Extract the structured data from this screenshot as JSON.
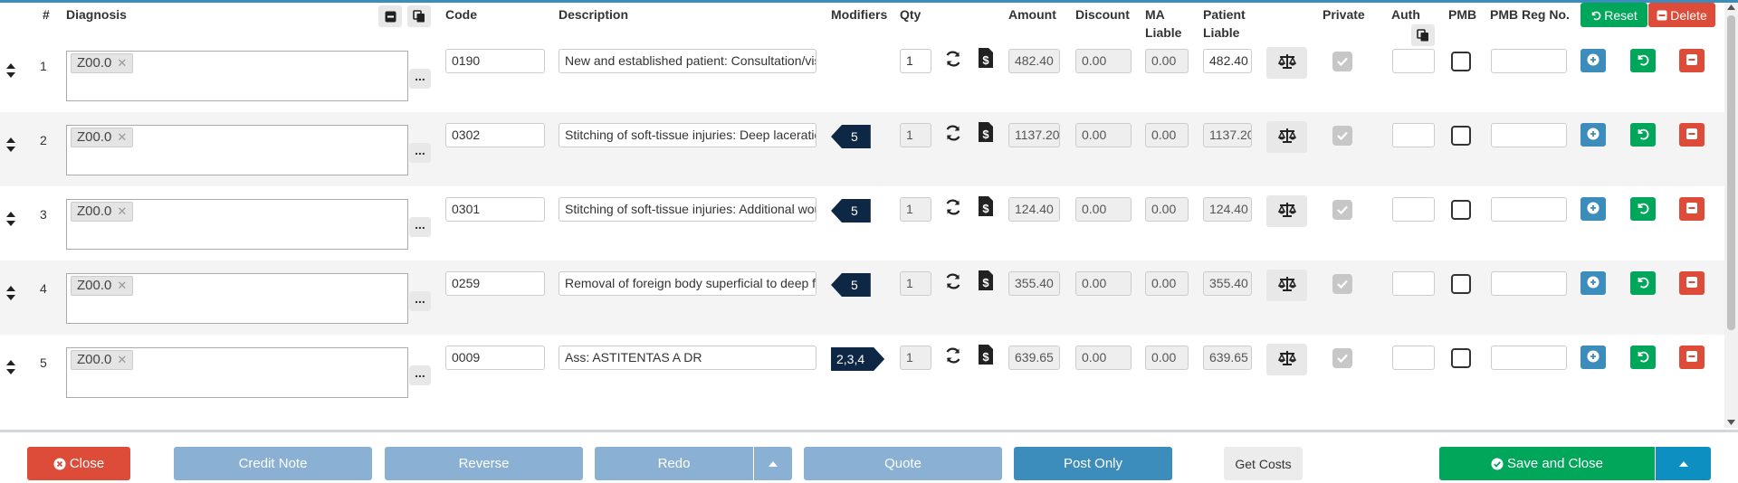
{
  "header": {
    "num": "#",
    "diagnosis": "Diagnosis",
    "code": "Code",
    "description": "Description",
    "modifiers": "Modifiers",
    "qty": "Qty",
    "amount": "Amount",
    "discount": "Discount",
    "ma_liable_1": "MA",
    "ma_liable_2": "Liable",
    "patient_liable_1": "Patient",
    "patient_liable_2": "Liable",
    "private": "Private",
    "auth": "Auth",
    "pmb": "PMB",
    "pmb_reg": "PMB Reg No.",
    "reset_label": "Reset",
    "delete_label": "Delete"
  },
  "rows": [
    {
      "num": "1",
      "diagnosis": "Z00.0",
      "code": "0190",
      "description": "New and established patient: Consultation/visit",
      "modifiers": "",
      "qty": "1",
      "amount": "482.40",
      "discount": "0.00",
      "ma_liable": "0.00",
      "patient_liable": "482.40"
    },
    {
      "num": "2",
      "diagnosis": "Z00.0",
      "code": "0302",
      "description": "Stitching of soft-tissue injuries: Deep laceration",
      "modifiers": "5",
      "qty": "1",
      "amount": "1137.20",
      "discount": "0.00",
      "ma_liable": "0.00",
      "patient_liable": "1137.20"
    },
    {
      "num": "3",
      "diagnosis": "Z00.0",
      "code": "0301",
      "description": "Stitching of soft-tissue injuries: Additional wound",
      "modifiers": "5",
      "qty": "1",
      "amount": "124.40",
      "discount": "0.00",
      "ma_liable": "0.00",
      "patient_liable": "124.40"
    },
    {
      "num": "4",
      "diagnosis": "Z00.0",
      "code": "0259",
      "description": "Removal of foreign body superficial to deep fascia",
      "modifiers": "5",
      "qty": "1",
      "amount": "355.40",
      "discount": "0.00",
      "ma_liable": "0.00",
      "patient_liable": "355.40"
    },
    {
      "num": "5",
      "diagnosis": "Z00.0",
      "code": "0009",
      "description": "Ass: ASTITENTAS A DR",
      "modifiers": "2,3,4",
      "qty": "1",
      "amount": "639.65",
      "discount": "0.00",
      "ma_liable": "0.00",
      "patient_liable": "639.65"
    }
  ],
  "footer": {
    "close": "Close",
    "credit_note": "Credit Note",
    "reverse": "Reverse",
    "redo": "Redo",
    "quote": "Quote",
    "post_only": "Post Only",
    "get_costs": "Get Costs",
    "save_and_close": "Save and Close"
  },
  "colors": {
    "primary": "#3c8dbc",
    "success": "#00a65a",
    "danger": "#dd4b39",
    "disabled_blue": "#8ab1d3",
    "modifier_tag": "#0d2745"
  }
}
